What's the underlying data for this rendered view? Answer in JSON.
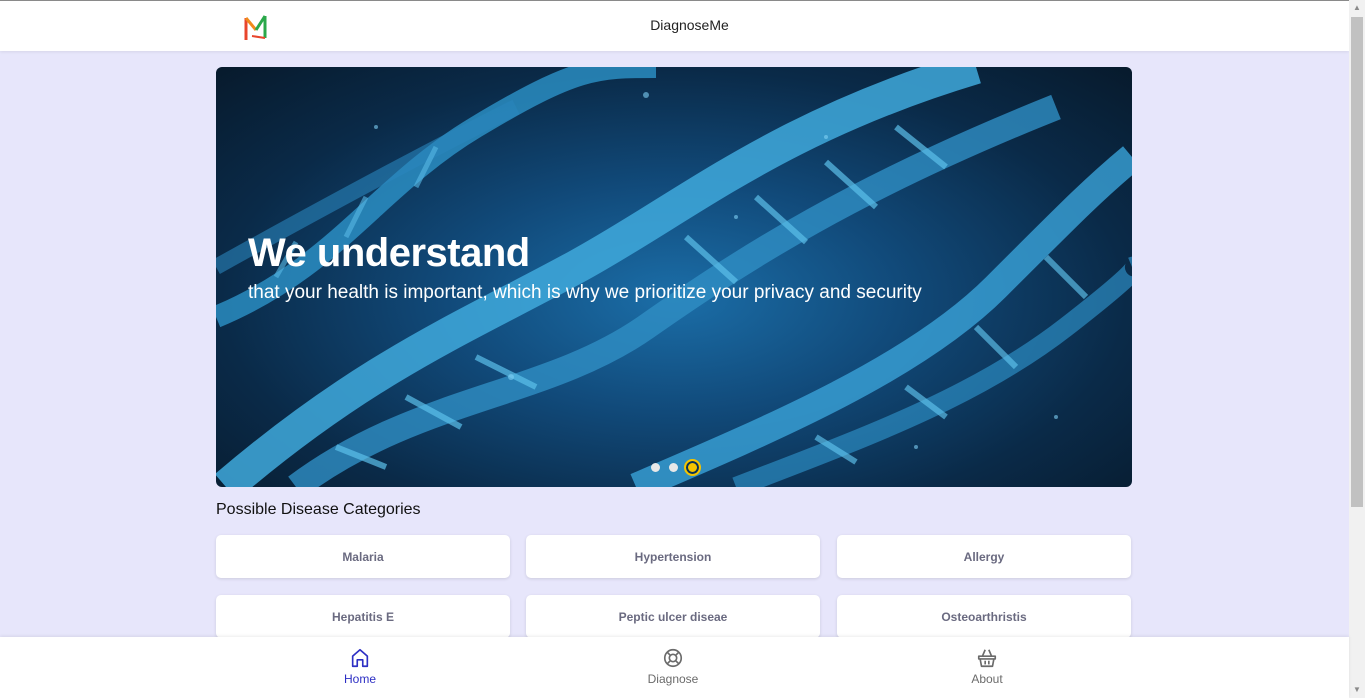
{
  "app": {
    "title": "DiagnoseMe",
    "logo_icon": "diagnoseme-logo-icon"
  },
  "hero": {
    "title": "We understand",
    "subtitle": "that your health is important, which is why we prioritize your privacy and security",
    "slides_count": 3,
    "active_slide": 3,
    "dot_active_color": "#f5c400"
  },
  "categories": {
    "title": "Possible Disease Categories",
    "items": [
      {
        "label": "Malaria"
      },
      {
        "label": "Hypertension"
      },
      {
        "label": "Allergy"
      },
      {
        "label": "Hepatitis E"
      },
      {
        "label": "Peptic ulcer diseae"
      },
      {
        "label": "Osteoarthristis"
      }
    ]
  },
  "bottom_nav": {
    "items": [
      {
        "label": "Home",
        "icon": "home-icon",
        "active": true
      },
      {
        "label": "Diagnose",
        "icon": "lifebuoy-icon",
        "active": false
      },
      {
        "label": "About",
        "icon": "basket-icon",
        "active": false
      }
    ],
    "active_color": "#2d2fc4"
  },
  "colors": {
    "background": "#e7e6fb",
    "card": "#ffffff"
  }
}
